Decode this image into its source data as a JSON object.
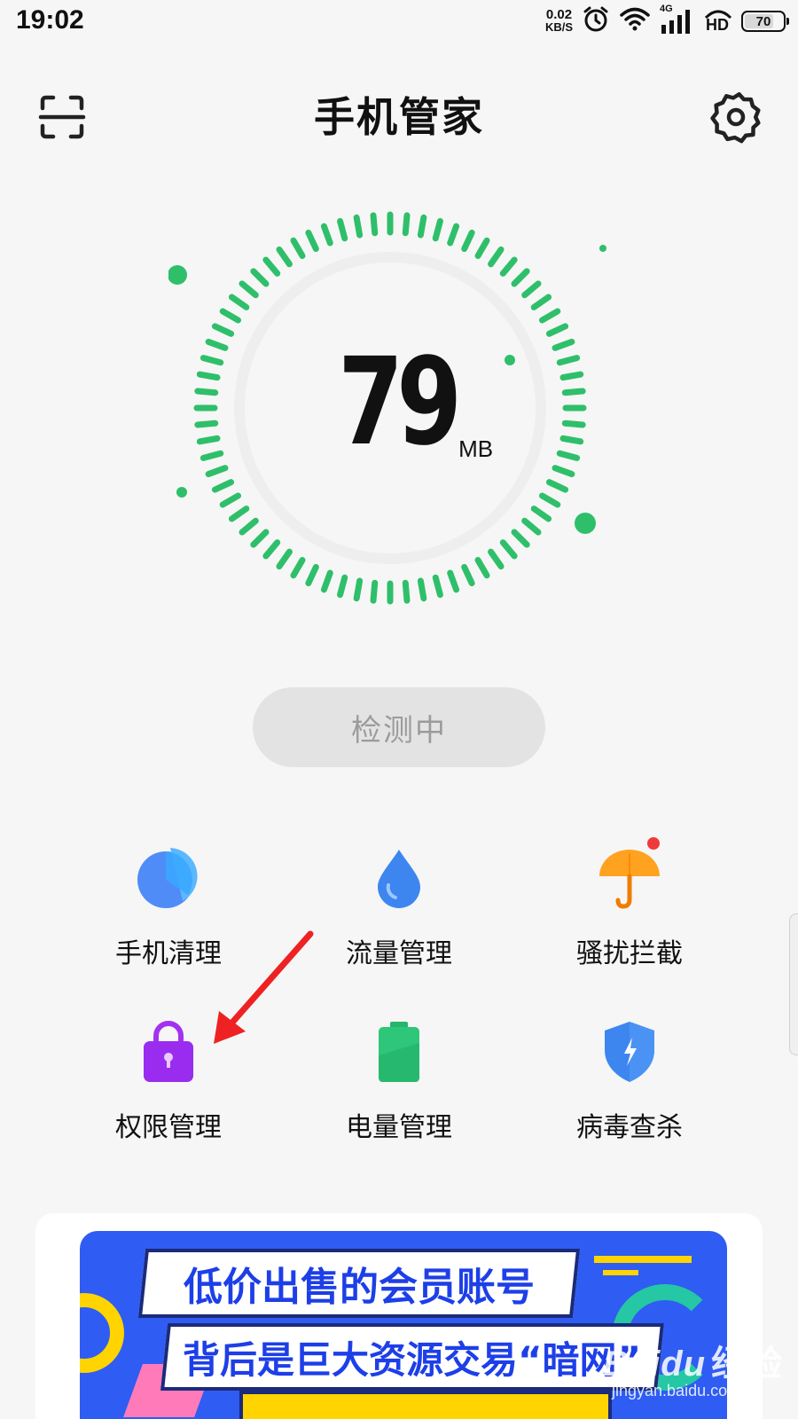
{
  "status_bar": {
    "time": "19:02",
    "net_speed_value": "0.02",
    "net_speed_unit": "KB/S",
    "network_type": "4G",
    "hd_label": "HD",
    "battery_level": "70"
  },
  "header": {
    "title": "手机管家"
  },
  "gauge": {
    "value": "79",
    "unit": "MB",
    "progress_color": "#2fbf6a"
  },
  "detect_button": {
    "label": "检测中"
  },
  "tools": [
    {
      "label": "手机清理",
      "icon": "pie-chart-icon"
    },
    {
      "label": "流量管理",
      "icon": "water-drop-icon"
    },
    {
      "label": "骚扰拦截",
      "icon": "umbrella-icon",
      "badge": true
    },
    {
      "label": "权限管理",
      "icon": "lock-icon"
    },
    {
      "label": "电量管理",
      "icon": "battery-icon"
    },
    {
      "label": "病毒查杀",
      "icon": "shield-icon"
    }
  ],
  "banner": {
    "title": "低价出售的会员账号",
    "subtitle": "背后是巨大资源交易“暗网”"
  },
  "watermark": {
    "brand": "Baidu",
    "sub": "经验",
    "url": "jingyan.baidu.com"
  }
}
